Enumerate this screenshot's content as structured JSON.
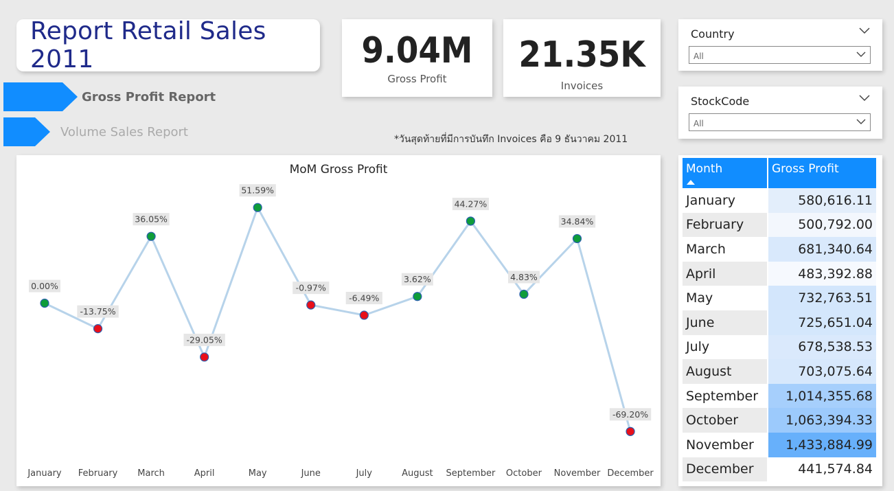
{
  "report_title": "Report Retail Sales 2011",
  "kpis": {
    "gross_profit": {
      "value": "9.04M",
      "label": "Gross Profit"
    },
    "invoices": {
      "value": "21.35K",
      "label": "Invoices"
    }
  },
  "nav": {
    "gross_profit_report": "Gross Profit Report",
    "volume_sales_report": "Volume Sales Report",
    "accent_color": "#118dff"
  },
  "note": "*วันสุดท้ายที่มีการบันทึก Invoices คือ 9 ธันวาคม 2011",
  "slicers": {
    "country": {
      "label": "Country",
      "value": "All"
    },
    "stockcode": {
      "label": "StockCode",
      "value": "All"
    }
  },
  "chart_data": {
    "type": "line",
    "title": "MoM Gross Profit",
    "categories": [
      "January",
      "February",
      "March",
      "April",
      "May",
      "June",
      "July",
      "August",
      "September",
      "October",
      "November",
      "December"
    ],
    "values": [
      0.0,
      -13.75,
      36.05,
      -29.05,
      51.59,
      -0.97,
      -6.49,
      3.62,
      44.27,
      4.83,
      34.84,
      -69.2
    ],
    "data_labels": [
      "0.00%",
      "-13.75%",
      "36.05%",
      "-29.05%",
      "51.59%",
      "-0.97%",
      "-6.49%",
      "3.62%",
      "44.27%",
      "4.83%",
      "34.84%",
      "-69.20%"
    ],
    "ylim": [
      -75,
      55
    ],
    "line_color": "#b7d3ea",
    "positive_color": "#0f9d3a",
    "negative_color": "#e8101a",
    "grid": false
  },
  "table": {
    "headers": [
      "Month",
      "Gross Profit"
    ],
    "rows": [
      {
        "month": "January",
        "profit": "580,616.11",
        "shade": "#e3eefb"
      },
      {
        "month": "February",
        "profit": "500,792.00",
        "shade": "#f3f7fd"
      },
      {
        "month": "March",
        "profit": "681,340.64",
        "shade": "#d9e9fc"
      },
      {
        "month": "April",
        "profit": "483,392.88",
        "shade": "#f6f9fe"
      },
      {
        "month": "May",
        "profit": "732,763.51",
        "shade": "#d3e6fc"
      },
      {
        "month": "June",
        "profit": "725,651.04",
        "shade": "#d4e7fc"
      },
      {
        "month": "July",
        "profit": "678,538.53",
        "shade": "#dae9fc"
      },
      {
        "month": "August",
        "profit": "703,075.64",
        "shade": "#d7e8fc"
      },
      {
        "month": "September",
        "profit": "1,014,355.68",
        "shade": "#a6cffc"
      },
      {
        "month": "October",
        "profit": "1,063,394.33",
        "shade": "#9ccafc"
      },
      {
        "month": "November",
        "profit": "1,433,884.99",
        "shade": "#67b0fb"
      },
      {
        "month": "December",
        "profit": "441,574.84",
        "shade": "#ffffff"
      }
    ]
  }
}
